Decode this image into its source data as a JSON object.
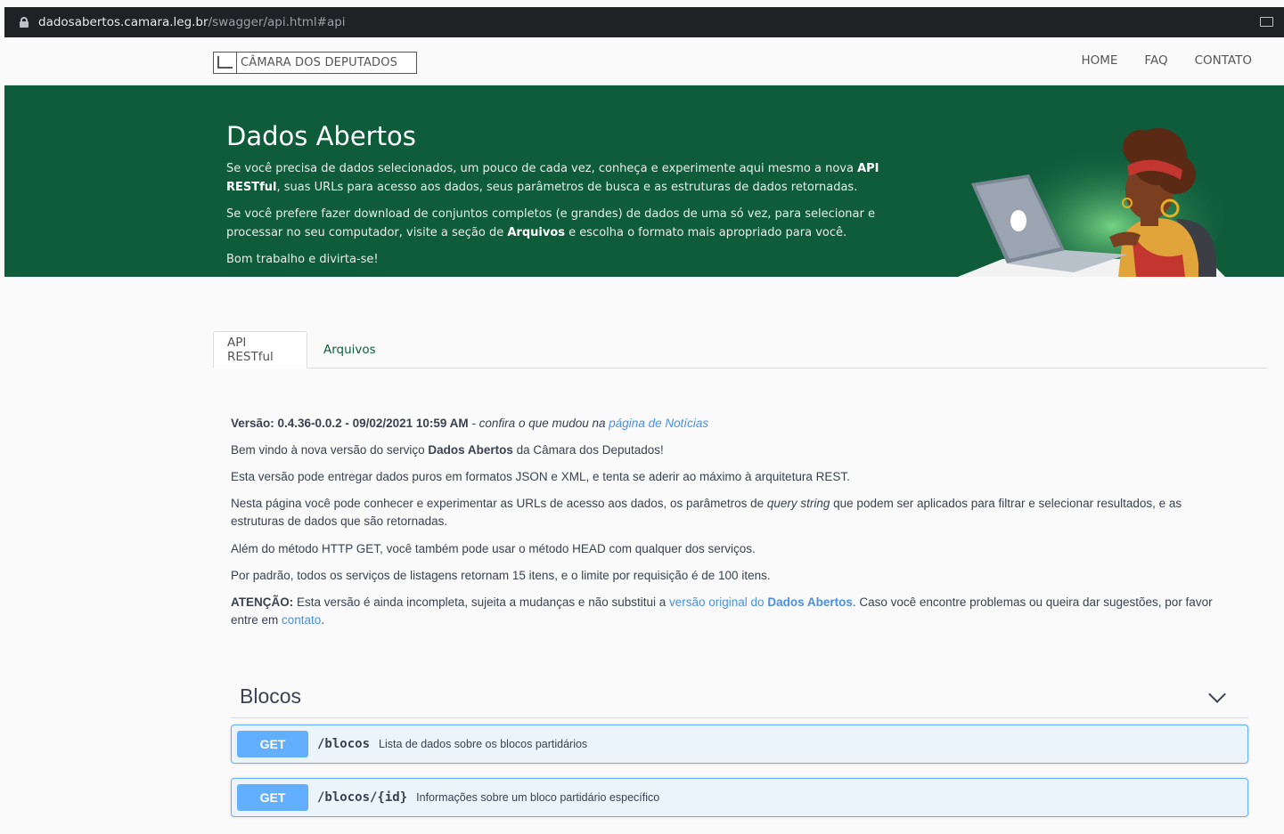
{
  "browser": {
    "domain": "dadosabertos.camara.leg.br",
    "path": "/swagger/api.html#api"
  },
  "header": {
    "logo_text": "CÂMARA DOS DEPUTADOS",
    "nav": [
      "HOME",
      "FAQ",
      "CONTATO"
    ]
  },
  "hero": {
    "title": "Dados Abertos",
    "p1_a": "Se você precisa de dados selecionados, um pouco de cada vez, conheça e experimente aqui mesmo a nova ",
    "p1_b": "API RESTful",
    "p1_c": ", suas URLs para acesso aos dados, seus parâmetros de busca e as estruturas de dados retornadas.",
    "p2_a": "Se você prefere fazer download de conjuntos completos (e grandes) de dados de uma só vez, para selecionar e processar no seu computador, visite a seção de ",
    "p2_b": "Arquivos",
    "p2_c": " e escolha o formato mais apropriado para você.",
    "p3": "Bom trabalho e divirta-se!"
  },
  "tabs": [
    "API RESTful",
    "Arquivos"
  ],
  "info": {
    "version_label": "Versão: 0.4.36-0.0.2 - 09/02/2021 10:59 AM",
    "version_note": " - confira o que mudou na ",
    "version_link": "página de Notícias",
    "welcome_a": "Bem vindo à nova versão do serviço ",
    "welcome_b": "Dados Abertos",
    "welcome_c": " da Câmara dos Deputados!",
    "formats": "Esta versão pode entregar dados puros em formatos JSON e XML, e tenta se aderir ao máximo à arquitetura REST.",
    "page_a": "Nesta página você pode conhecer e experimentar as URLs de acesso aos dados, os parâmetros de ",
    "page_b": "query string",
    "page_c": " que podem ser aplicados para filtrar e selecionar resultados, e as estruturas de dados que são retornadas.",
    "methods": "Além do método HTTP GET, você também pode usar o método HEAD com qualquer dos serviços.",
    "limits": "Por padrão, todos os serviços de listagens retornam 15 itens, e o limite por requisição é de 100 itens.",
    "attention_label": "ATENÇÃO:",
    "attention_a": " Esta versão é ainda incompleta, sujeita a mudanças e não substitui a ",
    "attention_link_a": "versão original do ",
    "attention_link_b": "Dados Abertos",
    "attention_b": ". Caso você encontre problemas ou queira dar sugestões, por favor entre em ",
    "attention_contact": "contato",
    "attention_end": "."
  },
  "section": {
    "title": "Blocos",
    "operations": [
      {
        "method": "GET",
        "path": "/blocos",
        "desc": "Lista de dados sobre os blocos partidários"
      },
      {
        "method": "GET",
        "path": "/blocos/{id}",
        "desc": "Informações sobre um bloco partidário específico"
      }
    ]
  },
  "colors": {
    "hero_bg": "#0f5c3b",
    "get_method": "#61affe",
    "link": "#4990e2"
  }
}
